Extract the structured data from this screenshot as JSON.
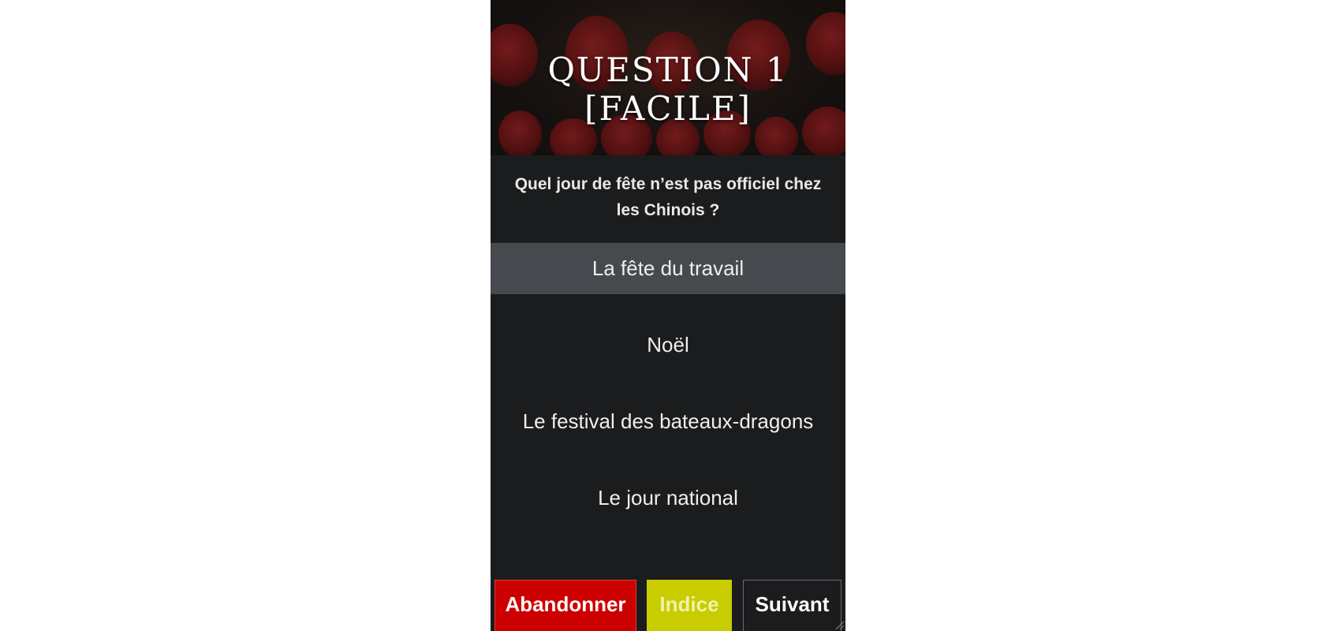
{
  "header": {
    "title": "QUESTION 1 [FACILE]"
  },
  "question": {
    "text": "Quel jour de fête n’est pas officiel chez les Chinois ?"
  },
  "answers": [
    {
      "label": "La fête du travail",
      "selected": true
    },
    {
      "label": "Noël",
      "selected": false
    },
    {
      "label": "Le festival des bateaux-dragons",
      "selected": false
    },
    {
      "label": "Le jour national",
      "selected": false
    }
  ],
  "actions": {
    "quit_label": "Abandonner",
    "hint_label": "Indice",
    "next_label": "Suivant"
  },
  "colors": {
    "background": "#1b1c1e",
    "selected_answer": "#464a4e",
    "quit": "#cc0000",
    "hint": "#c8cc00",
    "lantern": "#c4282a"
  }
}
